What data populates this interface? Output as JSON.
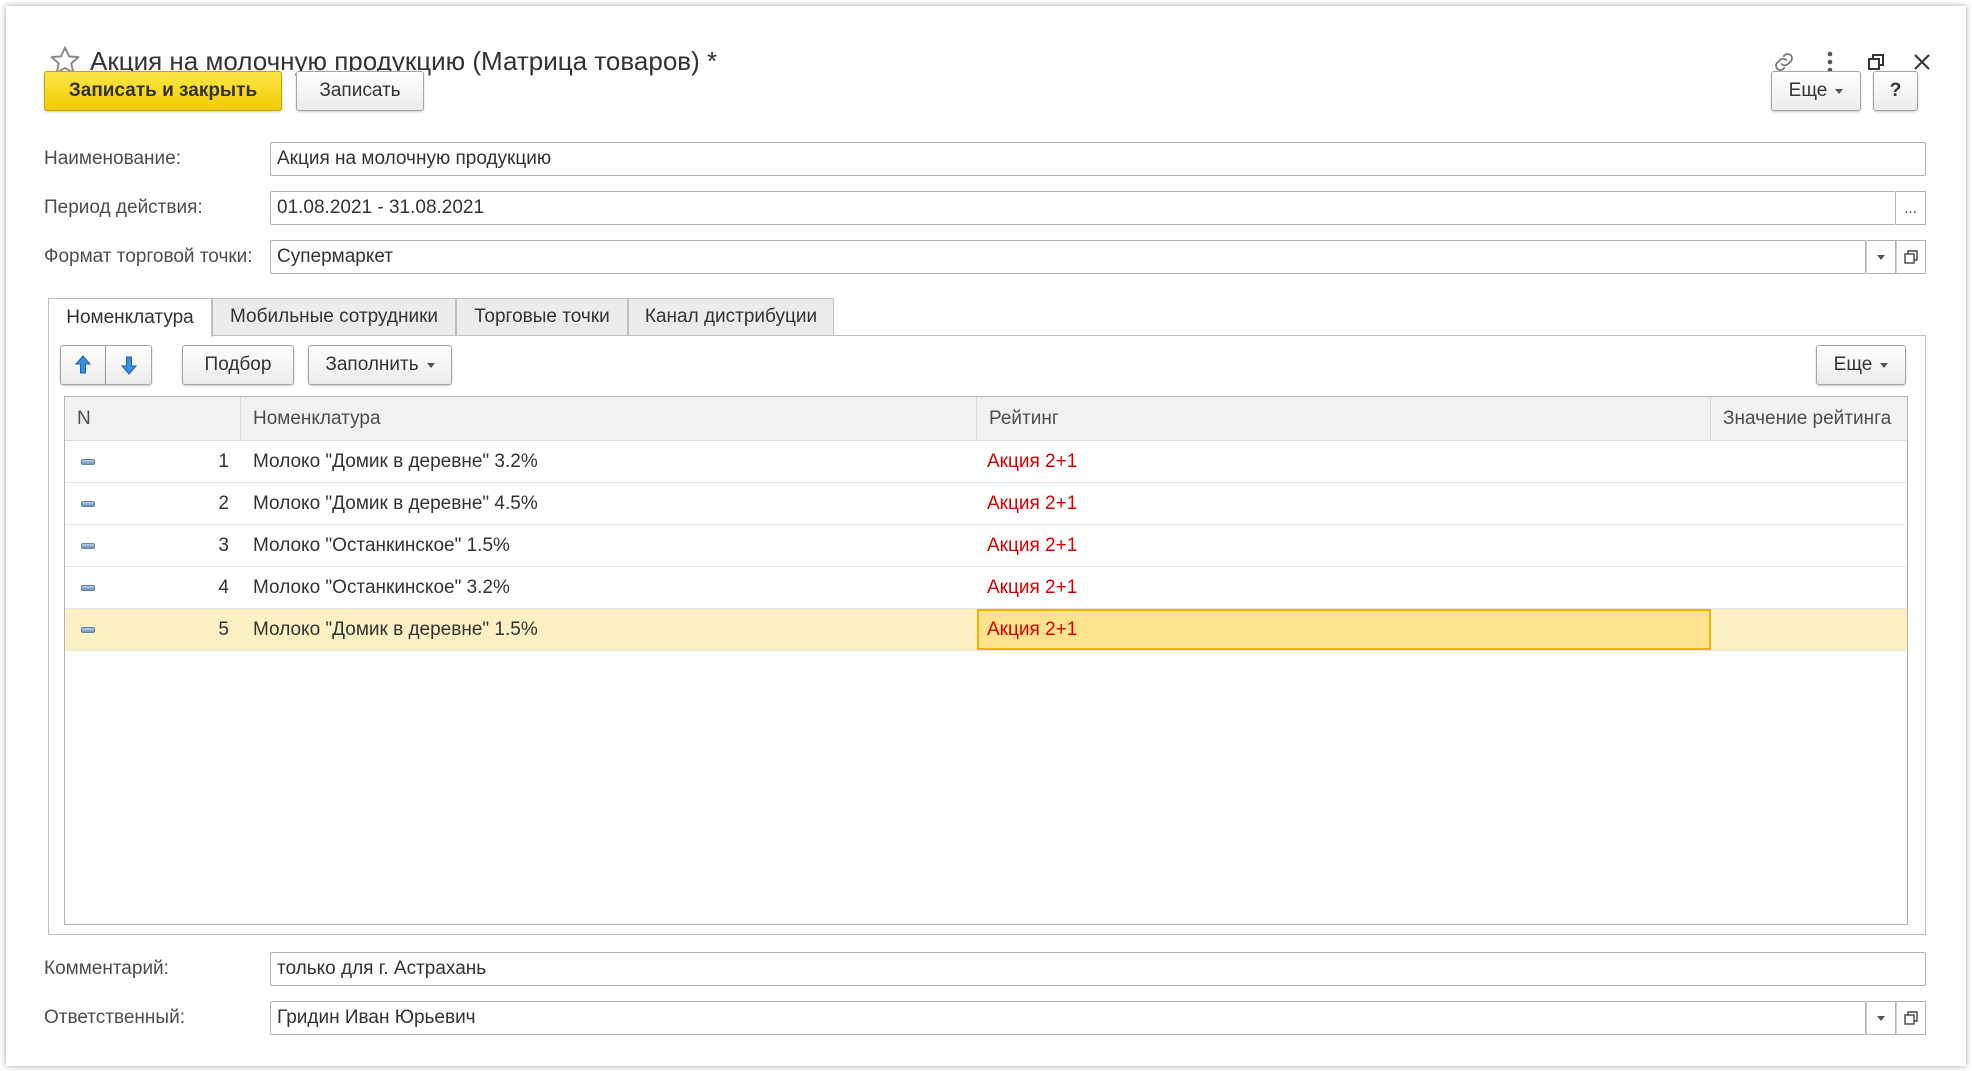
{
  "window": {
    "title": "Акция на молочную продукцию (Матрица товаров) *",
    "icons": [
      "star-icon",
      "link-icon",
      "more-vertical-icon",
      "restore-icon",
      "close-icon"
    ]
  },
  "toolbar": {
    "save_close_label": "Записать и закрыть",
    "save_label": "Записать",
    "more_label": "Еще",
    "help_label": "?"
  },
  "form": {
    "name": {
      "label": "Наименование:",
      "value": "Акция на молочную продукцию"
    },
    "period": {
      "label": "Период действия:",
      "value": "01.08.2021 - 31.08.2021",
      "button": "..."
    },
    "format": {
      "label": "Формат торговой точки:",
      "value": "Супермаркет"
    },
    "comment": {
      "label": "Комментарий:",
      "value": "только для г. Астрахань"
    },
    "responsible": {
      "label": "Ответственный:",
      "value": "Гридин Иван Юрьевич"
    }
  },
  "tabs": [
    {
      "label": "Номенклатура",
      "active": true
    },
    {
      "label": "Мобильные сотрудники",
      "active": false
    },
    {
      "label": "Торговые точки",
      "active": false
    },
    {
      "label": "Канал дистрибуции",
      "active": false
    }
  ],
  "table_toolbar": {
    "pick_label": "Подбор",
    "fill_label": "Заполнить",
    "more_label": "Еще"
  },
  "table": {
    "columns": [
      "N",
      "Номенклатура",
      "Рейтинг",
      "Значение рейтинга"
    ],
    "rows": [
      {
        "n": "1",
        "item": "Молоко \"Домик в деревне\" 3.2%",
        "rating": "Акция 2+1",
        "rating_value": ""
      },
      {
        "n": "2",
        "item": "Молоко \"Домик в деревне\" 4.5%",
        "rating": "Акция 2+1",
        "rating_value": ""
      },
      {
        "n": "3",
        "item": "Молоко \"Останкинское\" 1.5%",
        "rating": "Акция 2+1",
        "rating_value": ""
      },
      {
        "n": "4",
        "item": "Молоко \"Останкинское\" 3.2%",
        "rating": "Акция 2+1",
        "rating_value": ""
      },
      {
        "n": "5",
        "item": "Молоко \"Домик в деревне\" 1.5%",
        "rating": "Акция 2+1",
        "rating_value": ""
      }
    ],
    "selected_row": 5
  },
  "colors": {
    "accent_yellow": "#f2cc00",
    "rating_red": "#d90000",
    "selected_row": "#fdf1c4",
    "selected_cell": "#fde38e"
  }
}
